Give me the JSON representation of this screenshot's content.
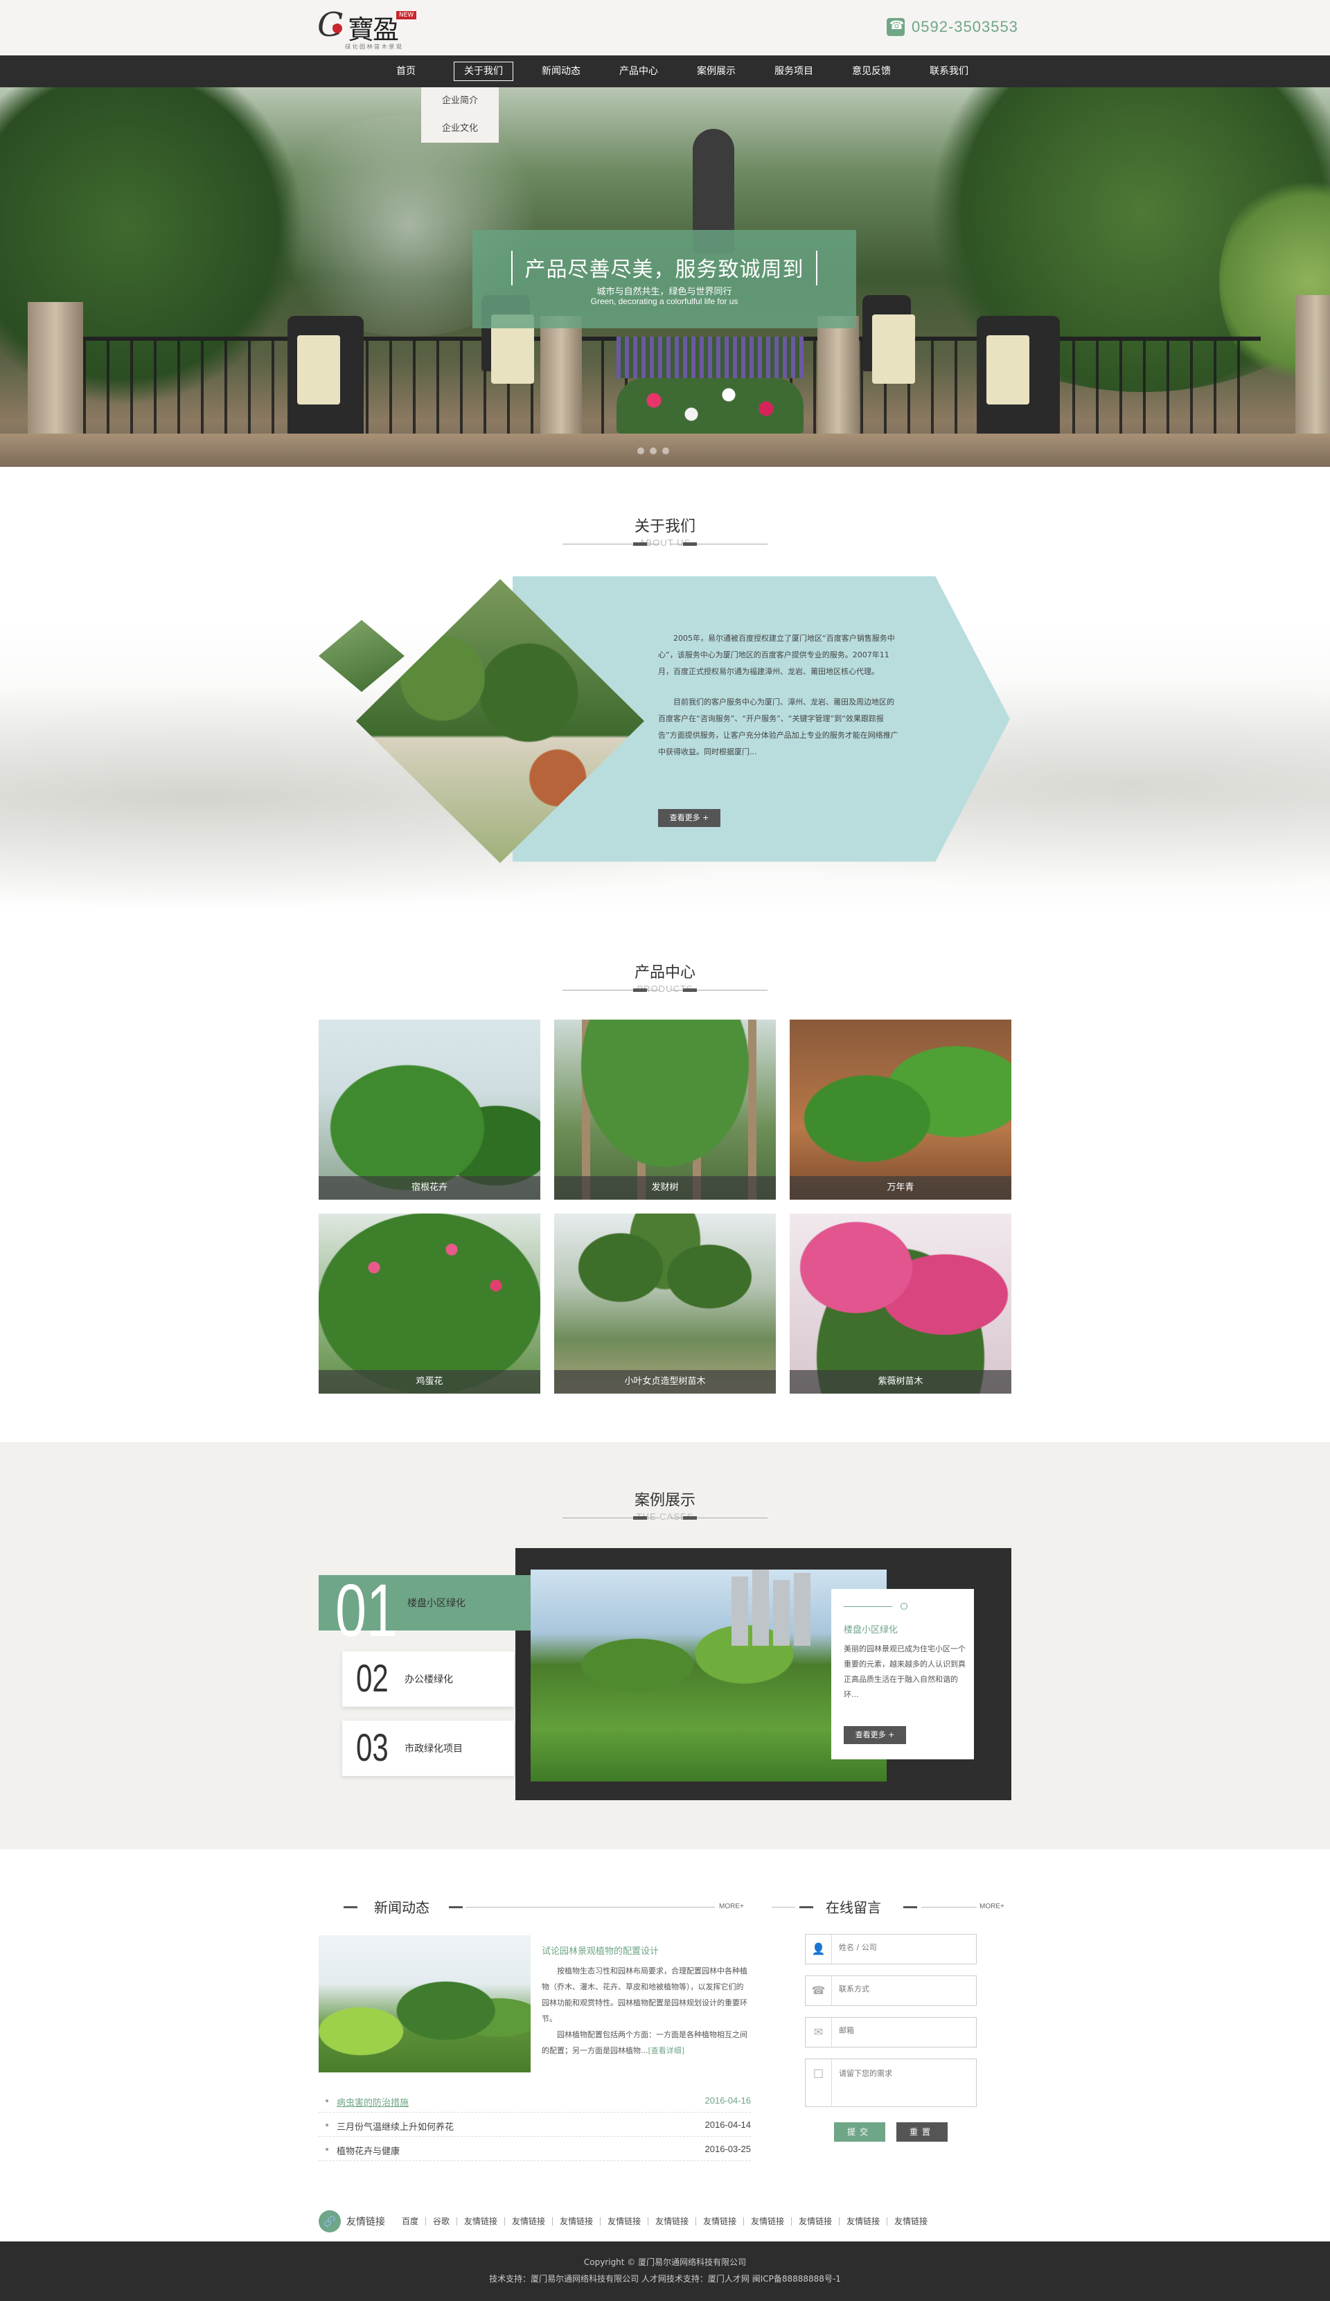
{
  "header": {
    "logo_letter": "G",
    "logo_text": "寶盈",
    "logo_badge": "NEW",
    "logo_tagline": "绿 化·园 林·苗 木·景 观",
    "phone": "0592-3503553"
  },
  "nav": {
    "items": [
      "首页",
      "关于我们",
      "新闻动态",
      "产品中心",
      "案例展示",
      "服务项目",
      "意见反馈",
      "联系我们"
    ],
    "dropdown": [
      "企业简介",
      "企业文化"
    ]
  },
  "banner": {
    "title": "产品尽善尽美，服务致诚周到",
    "subtitle": "城市与自然共生，绿色与世界同行",
    "subtitle_en": "Green, decorating a colorfulful life for us"
  },
  "about": {
    "title": "关于我们",
    "title_en": "ABOUT US",
    "para1": "2005年，易尔通被百度授权建立了厦门地区“百度客户销售服务中心”，该服务中心为厦门地区的百度客户提供专业的服务。2007年11月，百度正式授权易尔通为福建漳州、龙岩、莆田地区核心代理。",
    "para2": "目前我们的客户服务中心为厦门、漳州、龙岩、莆田及周边地区的百度客户在“咨询服务”、“开户服务”、“关键字管理”到“效果跟踪报告”方面提供服务，让客户充分体验产品加上专业的服务才能在网络推广中获得收益。同时根据厦门...",
    "more_button": "查看更多 +"
  },
  "products": {
    "title": "产品中心",
    "title_en": "PRODUCTS",
    "items": [
      {
        "name": "宿根花卉"
      },
      {
        "name": "发财树"
      },
      {
        "name": "万年青"
      },
      {
        "name": "鸡蛋花"
      },
      {
        "name": "小叶女贞造型树苗木"
      },
      {
        "name": "紫薇树苗木"
      }
    ]
  },
  "cases": {
    "title": "案例展示",
    "title_en": "THE CASES",
    "tabs": [
      {
        "num": "01",
        "label": "楼盘小区绿化"
      },
      {
        "num": "02",
        "label": "办公楼绿化"
      },
      {
        "num": "03",
        "label": "市政绿化项目"
      }
    ],
    "card_title": "楼盘小区绿化",
    "card_text": "美丽的园林景观已成为住宅小区一个重要的元素，越来越多的人认识到真正高品质生活在于融入自然和谐的环...",
    "card_button": "查看更多 +"
  },
  "news": {
    "title": "新闻动态",
    "more": "MORE+",
    "lead_title": "试论园林景观植物的配置设计",
    "lead_p1": "按植物生态习性和园林布局要求，合理配置园林中各种植物（乔木、灌木、花卉、草皮和地被植物等），以发挥它们的园林功能和观赏特性。园林植物配置是园林规划设计的重要环节。",
    "lead_p2": "园林植物配置包括两个方面：一方面是各种植物相互之间的配置；另一方面是园林植物...",
    "lead_more": "[查看详细]",
    "list": [
      {
        "title": "病虫害的防治措施",
        "date": "2016-04-16"
      },
      {
        "title": "三月份气温继续上升如何养花",
        "date": "2016-04-14"
      },
      {
        "title": "植物花卉与健康",
        "date": "2016-03-25"
      }
    ]
  },
  "message": {
    "title": "在线留言",
    "more": "MORE+",
    "name_placeholder": "姓名 / 公司",
    "contact_placeholder": "联系方式",
    "email_placeholder": "邮箱",
    "need_placeholder": "请留下您的需求",
    "submit": "提交",
    "reset": "重置"
  },
  "links": {
    "title": "友情链接",
    "items": [
      "百度",
      "谷歌",
      "友情链接",
      "友情链接",
      "友情链接",
      "友情链接",
      "友情链接",
      "友情链接",
      "友情链接",
      "友情链接",
      "友情链接",
      "友情链接"
    ]
  },
  "footer": {
    "copyright": "Copyright © 厦门易尔通网络科技有限公司",
    "support": "技术支持：厦门易尔通网络科技有限公司 人才网技术支持：厦门人才网 闽ICP备88888888号-1"
  },
  "colors": {
    "accent": "#6fa687",
    "nav_bg": "#2d2d2d",
    "about_bg": "#b9dddd",
    "case_panel": "#2e2e2e"
  }
}
